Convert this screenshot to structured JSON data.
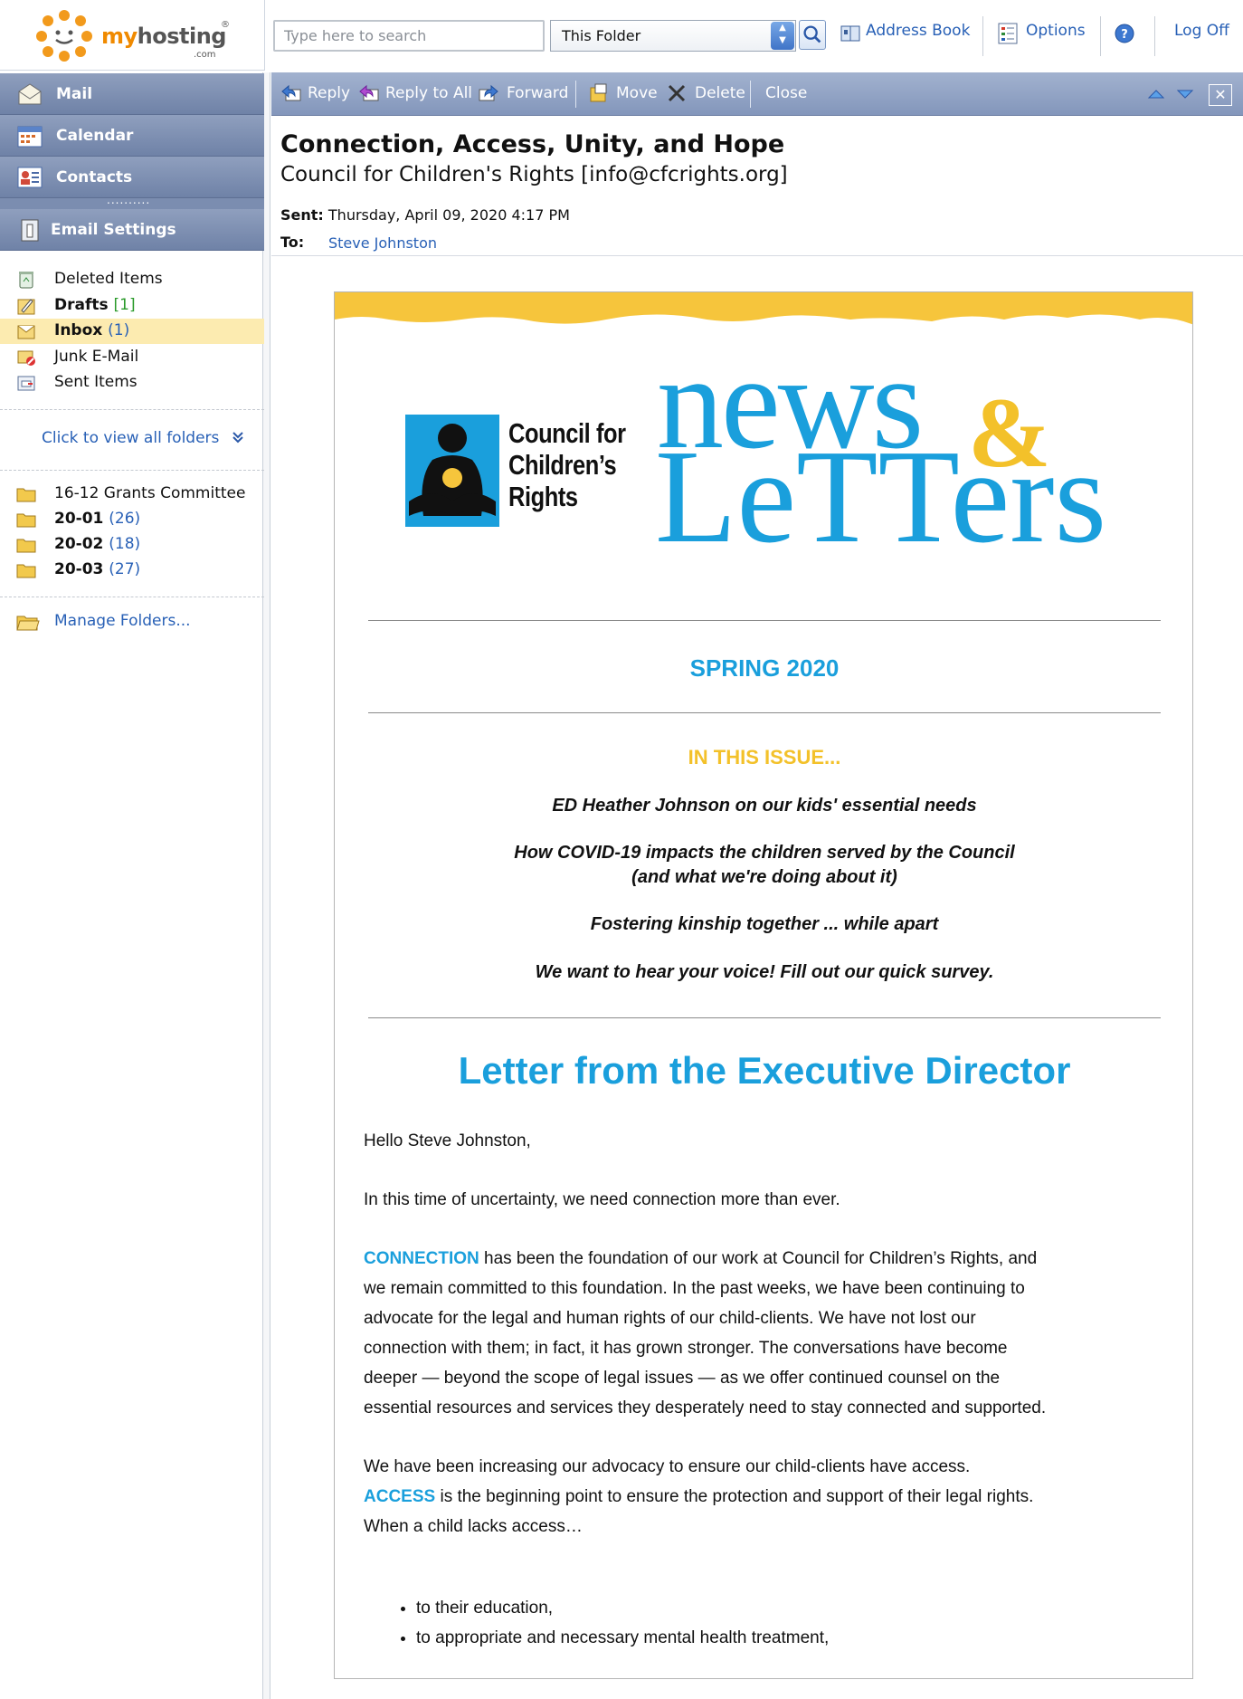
{
  "brand": {
    "logo_main": "my",
    "logo_host": "hosting",
    "logo_reg": "®",
    "logo_com": ".com"
  },
  "search": {
    "placeholder": "Type here to search",
    "scope": "This Folder"
  },
  "top_links": {
    "address_book": "Address Book",
    "options": "Options",
    "logoff": "Log Off"
  },
  "nav": {
    "mail": "Mail",
    "calendar": "Calendar",
    "contacts": "Contacts",
    "grip": "..........",
    "email_settings": "Email Settings"
  },
  "folders": [
    {
      "name": "Deleted Items",
      "count": ""
    },
    {
      "name": "Drafts",
      "count": "[1]"
    },
    {
      "name": "Inbox",
      "count": "(1)"
    },
    {
      "name": "Junk E-Mail",
      "count": ""
    },
    {
      "name": "Sent Items",
      "count": ""
    }
  ],
  "view_all": "Click to view all folders",
  "view_all_icon": "double-chevron-down",
  "custom_folders": [
    {
      "name": "16-12 Grants Committee",
      "count": ""
    },
    {
      "name": "20-01",
      "count": "(26)"
    },
    {
      "name": "20-02",
      "count": "(18)"
    },
    {
      "name": "20-03",
      "count": "(27)"
    }
  ],
  "manage_folders": "Manage Folders...",
  "toolbar": {
    "reply": "Reply",
    "reply_all": "Reply to All",
    "forward": "Forward",
    "move": "Move",
    "delete": "Delete",
    "close": "Close",
    "close_x": "✕"
  },
  "message": {
    "subject": "Connection, Access, Unity, and Hope",
    "from": "Council for Children's Rights [info@cfcrights.org]",
    "sent_label": "Sent:",
    "sent_value": "Thursday, April 09, 2020 4:17 PM",
    "to_label": "To:",
    "to_value": "Steve Johnston"
  },
  "newsletter": {
    "org_line1": "Council for",
    "org_line2": "Children’s",
    "org_line3": "Rights",
    "masthead_news": "news",
    "masthead_amp": "&",
    "masthead_letters": "LeTTers",
    "season": "SPRING 2020",
    "in_this_issue": "IN THIS ISSUE...",
    "items": [
      "ED Heather Johnson on our kids' essential needs",
      "How COVID-19 impacts the children served by the Council",
      "(and what we're doing about it)",
      "Fostering kinship together ... while apart",
      "We want to hear your voice! Fill out our quick survey."
    ],
    "letter_title": "Letter from the Executive Director",
    "greeting": "Hello Steve Johnston,",
    "para1": "In this time of uncertainty, we need connection more than ever.",
    "para2_kw": "CONNECTION",
    "para2_l1": " has been the foundation of our work at Council for Children’s Rights, and",
    "para2_l2": "we remain committed to this foundation. In the past weeks, we have been continuing to",
    "para2_l3": "advocate for the legal and human rights of our child-clients. We have not lost our",
    "para2_l4": "connection with them; in fact, it has grown stronger. The conversations have become",
    "para2_l5": "deeper — beyond the scope of legal issues — as we offer continued counsel on the",
    "para2_l6": "essential resources and services they desperately need to stay connected and supported.",
    "para3_l1": "We have been increasing our advocacy to ensure our child-clients have access.",
    "para3_kw": "ACCESS",
    "para3_l2": " is the beginning point to ensure the protection and support of their legal rights.",
    "para3_l3": "When a child lacks access…",
    "bullets": [
      "to their education,",
      "to appropriate and necessary mental health treatment,"
    ]
  },
  "colors": {
    "accent_blue": "#1a9fdc",
    "accent_yellow": "#f3c12a",
    "link": "#2860b6",
    "toolbar": "#8396bb",
    "logo_orange": "#f08a00"
  }
}
